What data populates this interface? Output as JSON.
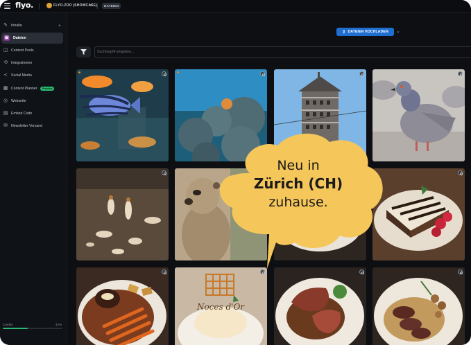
{
  "app": {
    "logo": "flyo."
  },
  "workspace": {
    "name": "FLYO.ZOO (SHOWCASE)",
    "breadcrumb": "DATEIEN"
  },
  "sidebar": {
    "items": [
      {
        "label": "Inhalte",
        "icon": "edit-icon"
      },
      {
        "label": "Dateien",
        "icon": "image-icon"
      },
      {
        "label": "Content Pools",
        "icon": "pool-icon"
      },
      {
        "label": "Integrationen",
        "icon": "integration-icon"
      },
      {
        "label": "Social Media",
        "icon": "share-icon"
      },
      {
        "label": "Content Planner",
        "icon": "calendar-icon",
        "badge": "Preview"
      },
      {
        "label": "Webseite",
        "icon": "globe-icon"
      },
      {
        "label": "Embed Code",
        "icon": "code-icon"
      },
      {
        "label": "Newsletter Versand",
        "icon": "mail-icon"
      }
    ],
    "credits": {
      "label": "Credits",
      "percent_text": "42%",
      "fraction": 0.42
    }
  },
  "toolbar": {
    "upload_label": "DATEIEN HOCHLADEN",
    "search_placeholder": "Suchbegriff eingeben..."
  },
  "grid": {
    "tiles": [
      "aquarium-fish",
      "coral-reef",
      "dovecote-tower",
      "pigeon",
      "termites",
      "meerkat",
      "tiramisu-plate",
      "tiramisu",
      "steak-carrots",
      "noces-dor-dessert",
      "steak-sauce",
      "duck-mushrooms"
    ],
    "dessert_text": "Noces d'Or"
  },
  "bubble": {
    "line1": "Neu in",
    "line2": "Zürich (CH)",
    "line3": "zuhause.",
    "color": "#f5c659"
  },
  "colors": {
    "accent": "#1f6fd1",
    "active_icon": "#7a2e8f",
    "badge": "#2bb673"
  }
}
